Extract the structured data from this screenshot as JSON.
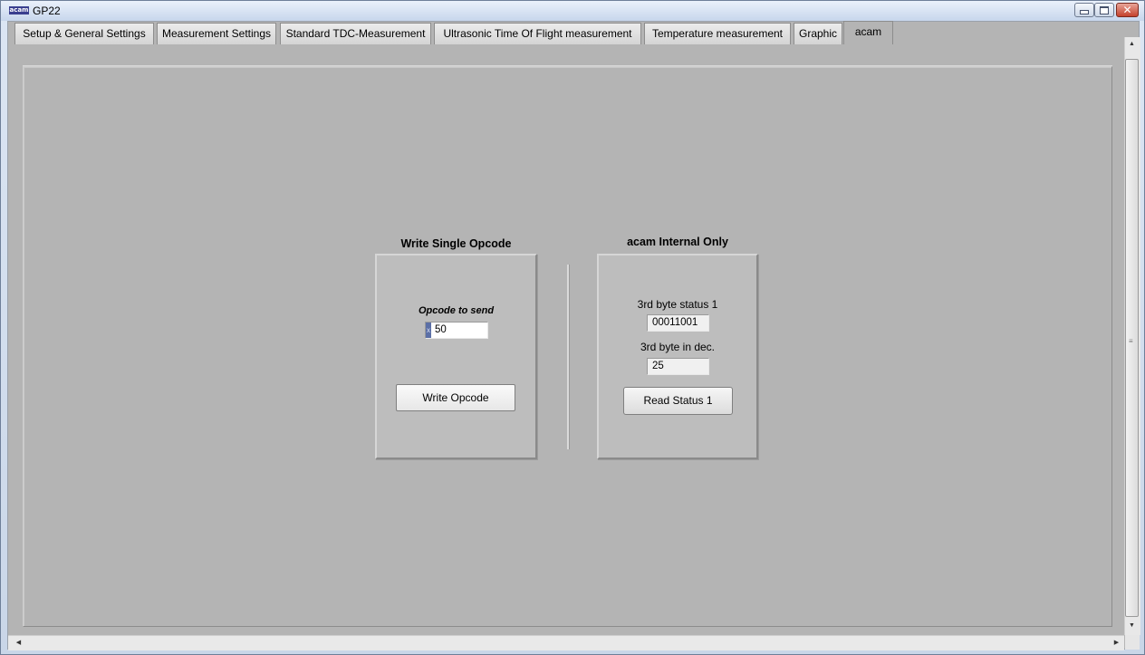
{
  "window": {
    "title": "GP22",
    "icon_text": "acam",
    "controls": {
      "minimize": "minimize-icon",
      "maximize": "maximize-icon",
      "close": "✕"
    }
  },
  "tabs": [
    {
      "label": "Setup & General Settings",
      "active": false
    },
    {
      "label": "Measurement Settings",
      "active": false
    },
    {
      "label": "Standard TDC-Measurement",
      "active": false
    },
    {
      "label": "Ultrasonic Time Of Flight measurement",
      "active": false
    },
    {
      "label": "Temperature measurement",
      "active": false
    },
    {
      "label": "Graphic",
      "active": false
    },
    {
      "label": "acam",
      "active": true
    }
  ],
  "write_opcode": {
    "title": "Write Single Opcode",
    "opcode_label": "Opcode to send",
    "radix": "x",
    "opcode_value": "50",
    "button_label": "Write Opcode"
  },
  "internal": {
    "title": "acam Internal Only",
    "status_label": "3rd byte status 1",
    "status_value": "00011001",
    "dec_label": "3rd byte in dec.",
    "dec_value": "25",
    "button_label": "Read Status 1"
  },
  "scrollbars": {
    "up_arrow": "▲",
    "down_arrow": "▼",
    "left_arrow": "◀",
    "right_arrow": "▶",
    "grip": "≡"
  }
}
